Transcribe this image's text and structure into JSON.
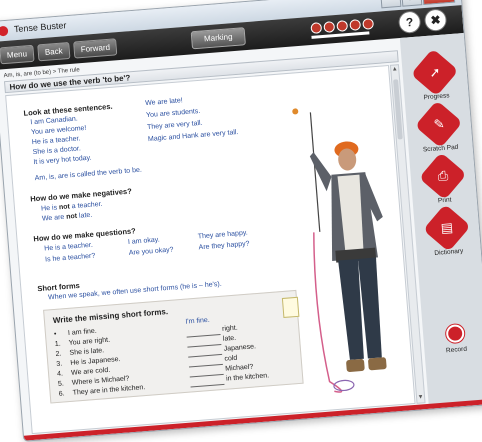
{
  "window": {
    "title": "Tense Buster"
  },
  "toolbar": {
    "menu_label": "Menu",
    "back_label": "Back",
    "forward_label": "Forward",
    "marking_label": "Marking",
    "help_label": "?",
    "close_label": "✖"
  },
  "breadcrumb": "Am, is, are (to be) > The rule",
  "question_title": "How do we use the verb 'to be'?",
  "section1": {
    "heading": "Look at these sentences.",
    "left": [
      "I am Canadian.",
      "You are welcome!",
      "He is a teacher.",
      "She is a doctor.",
      "It is very hot today."
    ],
    "right": [
      "We are late!",
      "You are students.",
      "They are very tall.",
      "Magic and Hank are very tall."
    ],
    "note": "Am, is, are is called the verb to be."
  },
  "negatives": {
    "heading": "How do we make negatives?",
    "lines": [
      {
        "pre": "He is ",
        "em": "not",
        "post": " a teacher."
      },
      {
        "pre": "We are ",
        "em": "not",
        "post": " late."
      }
    ]
  },
  "questions": {
    "heading": "How do we make questions?",
    "col1": [
      "He is a teacher.",
      "Is he a teacher?"
    ],
    "col2": [
      "I am okay.",
      "Are you okay?"
    ],
    "col3": [
      "They are happy.",
      "Are they happy?"
    ]
  },
  "short_forms": {
    "heading": "Short forms",
    "text": "When we speak, we often use short forms (he is – he's)."
  },
  "exercise": {
    "heading": "Write the missing short forms.",
    "items": [
      {
        "num": "•",
        "sentence": "I am fine.",
        "answer": "I'm fine."
      },
      {
        "num": "1.",
        "sentence": "You are right.",
        "answer": "right."
      },
      {
        "num": "2.",
        "sentence": "She is late.",
        "answer": "late."
      },
      {
        "num": "3.",
        "sentence": "He is Japanese.",
        "answer": "Japanese."
      },
      {
        "num": "4.",
        "sentence": "We are cold.",
        "answer": "cold"
      },
      {
        "num": "5.",
        "sentence": "Where is Michael?",
        "answer": "Michael?"
      },
      {
        "num": "6.",
        "sentence": "They are in the kitchen.",
        "answer": "in the kitchen."
      }
    ]
  },
  "sidebar": {
    "items": [
      {
        "label": "Progress",
        "icon": "progress-icon"
      },
      {
        "label": "Scratch Pad",
        "icon": "scratch-pad-icon"
      },
      {
        "label": "Print",
        "icon": "print-icon"
      },
      {
        "label": "Dictionary",
        "icon": "dictionary-icon"
      },
      {
        "label": "Record",
        "icon": "record-icon"
      }
    ]
  },
  "colors": {
    "accent": "#cc2129",
    "text_blue": "#2a4fa0",
    "toolbar": "#2a2a2a"
  }
}
